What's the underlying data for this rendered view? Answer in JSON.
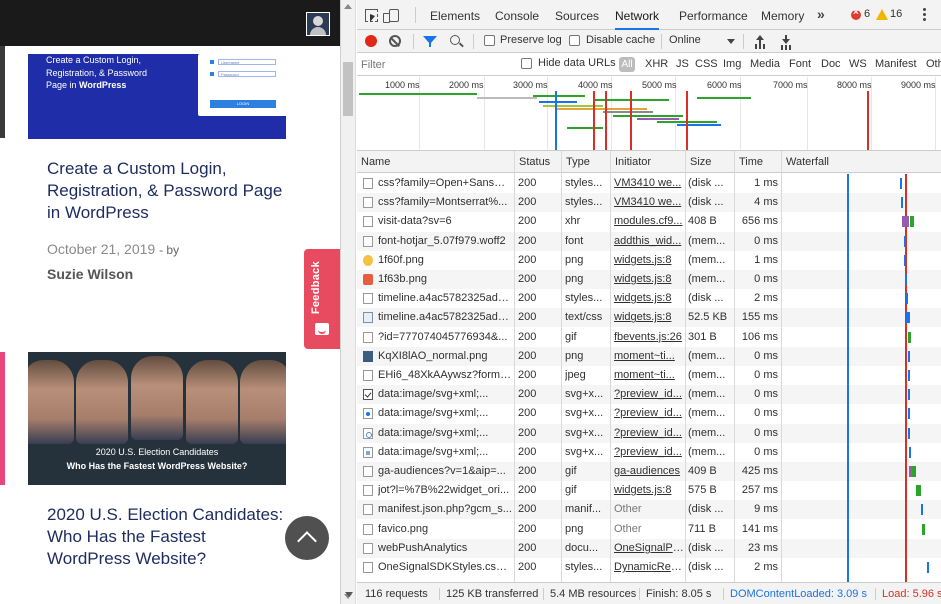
{
  "webpage": {
    "post1": {
      "thumb_title_line1": "Create a Custom Login,",
      "thumb_title_line2": "Registration, & Password",
      "thumb_title_line3_prefix": "Page in ",
      "thumb_title_line3_bold": "WordPress",
      "form_username": "Username",
      "form_password": "Password",
      "form_button": "LOGIN",
      "title": "Create a Custom Login, Registration, & Password Page in WordPress",
      "date": "October 21, 2019",
      "by": "- by",
      "author": "Suzie Wilson"
    },
    "post2": {
      "thumb_caption_line1": "2020 U.S. Election Candidates",
      "thumb_caption_line2": "Who Has the Fastest WordPress Website?",
      "title": "2020 U.S. Election Candidates: Who Has the Fastest WordPress Website?"
    },
    "feedback_label": "Feedback",
    "colors": {
      "header": "#1a1a1a",
      "feedback": "#e84a5f",
      "link_title": "#1d2b5f",
      "thumb1_bg": "#1f2ea8"
    }
  },
  "devtools": {
    "tabs": [
      "Elements",
      "Console",
      "Sources",
      "Network",
      "Performance",
      "Memory"
    ],
    "active_tab": "Network",
    "more_tabs_glyph": "»",
    "errors": "6",
    "warnings": "16",
    "toolbar": {
      "preserve_log": "Preserve log",
      "disable_cache": "Disable cache",
      "throttling": "Online"
    },
    "filter": {
      "placeholder": "Filter",
      "hide_data_urls": "Hide data URLs",
      "all": "All",
      "types": [
        "XHR",
        "JS",
        "CSS",
        "Img",
        "Media",
        "Font",
        "Doc",
        "WS",
        "Manifest",
        "Oth"
      ]
    },
    "overview_ticks": [
      "1000 ms",
      "2000 ms",
      "3000 ms",
      "4000 ms",
      "5000 ms",
      "6000 ms",
      "7000 ms",
      "8000 ms",
      "9000 ms"
    ],
    "columns": [
      "Name",
      "Status",
      "Type",
      "Initiator",
      "Size",
      "Time",
      "Waterfall"
    ],
    "requests": [
      {
        "name": "css?family=Open+Sans%...",
        "status": "200",
        "type": "styles...",
        "initiator": "VM3410 we...",
        "size": "(disk ...",
        "time": "1 ms",
        "icon": "doc"
      },
      {
        "name": "css?family=Montserrat%...",
        "status": "200",
        "type": "styles...",
        "initiator": "VM3410 we...",
        "size": "(disk ...",
        "time": "4 ms",
        "icon": "doc"
      },
      {
        "name": "visit-data?sv=6",
        "status": "200",
        "type": "xhr",
        "initiator": "modules.cf9...",
        "size": "408 B",
        "time": "656 ms",
        "icon": "doc"
      },
      {
        "name": "font-hotjar_5.07f979.woff2",
        "status": "200",
        "type": "font",
        "initiator": "addthis_wid...",
        "size": "(mem...",
        "time": "0 ms",
        "icon": "doc"
      },
      {
        "name": "1f60f.png",
        "status": "200",
        "type": "png",
        "initiator": "widgets.js:8",
        "size": "(mem...",
        "time": "1 ms",
        "icon": "emoji-yellow"
      },
      {
        "name": "1f63b.png",
        "status": "200",
        "type": "png",
        "initiator": "widgets.js:8",
        "size": "(mem...",
        "time": "0 ms",
        "icon": "emoji-red"
      },
      {
        "name": "timeline.a4ac5782325ad1...",
        "status": "200",
        "type": "styles...",
        "initiator": "widgets.js:8",
        "size": "(disk ...",
        "time": "2 ms",
        "icon": "doc"
      },
      {
        "name": "timeline.a4ac5782325ad1...",
        "status": "200",
        "type": "text/css",
        "initiator": "widgets.js:8",
        "size": "52.5 KB",
        "time": "155 ms",
        "icon": "img"
      },
      {
        "name": "?id=777074045776934&...",
        "status": "200",
        "type": "gif",
        "initiator": "fbevents.js:26",
        "size": "301 B",
        "time": "106 ms",
        "icon": "doc"
      },
      {
        "name": "KqXI8lAO_normal.png",
        "status": "200",
        "type": "png",
        "initiator": "moment~ti...",
        "size": "(mem...",
        "time": "0 ms",
        "icon": "thumb"
      },
      {
        "name": "EHi6_48XkAAywsz?forma...",
        "status": "200",
        "type": "jpeg",
        "initiator": "moment~ti...",
        "size": "(mem...",
        "time": "0 ms",
        "icon": "doc"
      },
      {
        "name": "data:image/svg+xml;...",
        "status": "200",
        "type": "svg+x...",
        "initiator": "?preview_id...",
        "size": "(mem...",
        "time": "0 ms",
        "icon": "check"
      },
      {
        "name": "data:image/svg+xml;...",
        "status": "200",
        "type": "svg+x...",
        "initiator": "?preview_id...",
        "size": "(mem...",
        "time": "0 ms",
        "icon": "svg1"
      },
      {
        "name": "data:image/svg+xml;...",
        "status": "200",
        "type": "svg+x...",
        "initiator": "?preview_id...",
        "size": "(mem...",
        "time": "0 ms",
        "icon": "svg2"
      },
      {
        "name": "data:image/svg+xml;...",
        "status": "200",
        "type": "svg+x...",
        "initiator": "?preview_id...",
        "size": "(mem...",
        "time": "0 ms",
        "icon": "svg3"
      },
      {
        "name": "ga-audiences?v=1&aip=...",
        "status": "200",
        "type": "gif",
        "initiator": "ga-audiences",
        "size": "409 B",
        "time": "425 ms",
        "icon": "doc"
      },
      {
        "name": "jot?l=%7B%22widget_ori...",
        "status": "200",
        "type": "gif",
        "initiator": "widgets.js:8",
        "size": "575 B",
        "time": "257 ms",
        "icon": "doc"
      },
      {
        "name": "manifest.json.php?gcm_s...",
        "status": "200",
        "type": "manif...",
        "initiator": "Other",
        "size": "(disk ...",
        "time": "9 ms",
        "icon": "doc"
      },
      {
        "name": "favico.png",
        "status": "200",
        "type": "png",
        "initiator": "Other",
        "size": "711 B",
        "time": "141 ms",
        "icon": "doc"
      },
      {
        "name": "webPushAnalytics",
        "status": "200",
        "type": "docu...",
        "initiator": "OneSignalPa...",
        "size": "(disk ...",
        "time": "23 ms",
        "icon": "doc"
      },
      {
        "name": "OneSignalSDKStyles.css?...",
        "status": "200",
        "type": "styles...",
        "initiator": "DynamicRes...",
        "size": "(disk ...",
        "time": "2 ms",
        "icon": "doc"
      }
    ],
    "statusbar": {
      "requests": "116 requests",
      "transferred": "125 KB transferred",
      "resources": "5.4 MB resources",
      "finish": "Finish: 8.05 s",
      "dom_content_loaded": "DOMContentLoaded: 3.09 s",
      "load": "Load: 5.96 s"
    },
    "colors": {
      "accent": "#1a73e8",
      "record": "#e0271a",
      "dcl_line": "#1a73e8",
      "load_line": "#d93025"
    }
  }
}
